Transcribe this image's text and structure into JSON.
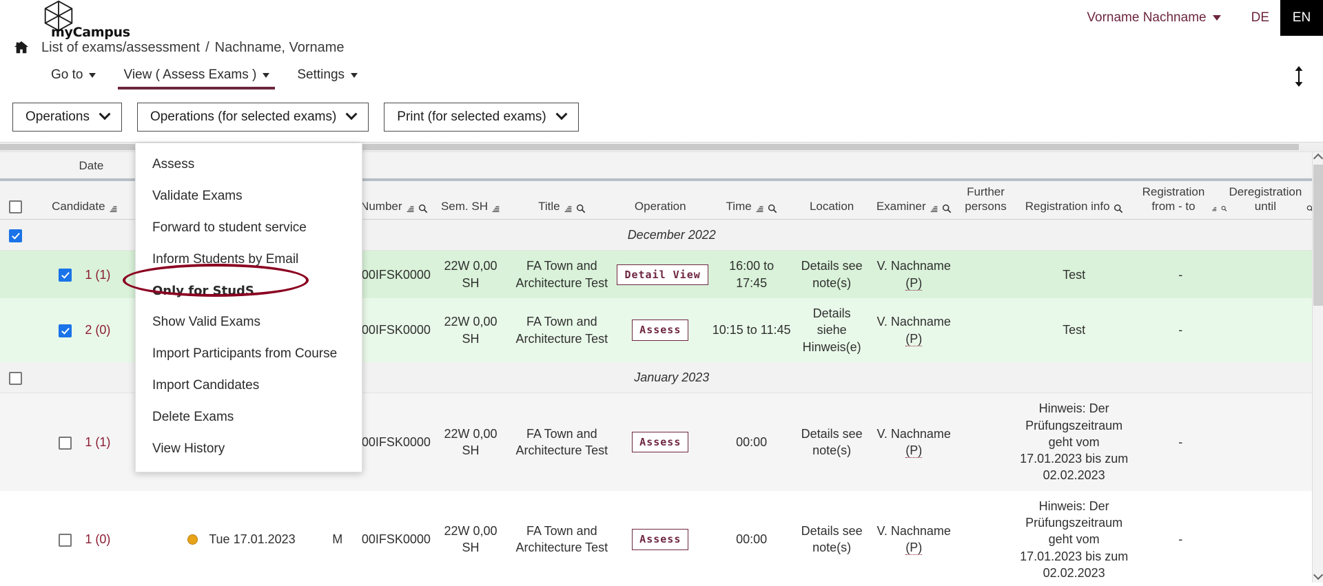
{
  "app": {
    "logo_text": "myCampus",
    "logo_icon": "hexagon-logo-icon"
  },
  "header": {
    "user_name": "Vorname Nachname",
    "lang_de": "DE",
    "lang_en": "EN"
  },
  "breadcrumb": {
    "home_icon": "home-icon",
    "page": "List of exams/assessment",
    "separator": "/",
    "person": "Nachname, Vorname"
  },
  "menubar": {
    "items": [
      {
        "label": "Go to",
        "active": false
      },
      {
        "label": "View ( Assess Exams )",
        "active": true
      },
      {
        "label": "Settings",
        "active": false
      }
    ],
    "expand_icon": "expand-collapse-icon"
  },
  "toolbar": {
    "operations": "Operations",
    "operations_selected": "Operations (for selected exams)",
    "print_selected": "Print (for selected exams)"
  },
  "dropdown": {
    "open_for": "Operations (for selected exams)",
    "items": [
      {
        "label": "Assess",
        "bold": false
      },
      {
        "label": "Validate Exams",
        "bold": false
      },
      {
        "label": "Forward to student service",
        "bold": false
      },
      {
        "label": "Inform Students by Email",
        "bold": false,
        "highlighted": true
      },
      {
        "label": "Only for StudS",
        "bold": true
      },
      {
        "label": "Show Valid Exams",
        "bold": false
      },
      {
        "label": "Import Participants from Course",
        "bold": false
      },
      {
        "label": "Import Candidates",
        "bold": false
      },
      {
        "label": "Delete Exams",
        "bold": false
      },
      {
        "label": "View History",
        "bold": false
      }
    ]
  },
  "table": {
    "group_label": "Date",
    "columns": [
      {
        "label": "Candidate",
        "sort": true,
        "search": true
      },
      {
        "label": "",
        "sort": false,
        "search": false
      },
      {
        "label": "",
        "sort": true,
        "search": true
      },
      {
        "label": "Number",
        "sort": true,
        "search": true
      },
      {
        "label": "Sem. SH",
        "sort": true,
        "search": false
      },
      {
        "label": "Title",
        "sort": true,
        "search": true
      },
      {
        "label": "Operation",
        "sort": false,
        "search": false
      },
      {
        "label": "Time",
        "sort": true,
        "search": true
      },
      {
        "label": "Location",
        "sort": false,
        "search": false
      },
      {
        "label": "Examiner",
        "sort": true,
        "search": true
      },
      {
        "label": "Further persons",
        "sort": false,
        "search": false
      },
      {
        "label": "Registration info",
        "sort": false,
        "search": true
      },
      {
        "label": "Registration from - to",
        "sort": true,
        "search": true
      },
      {
        "label": "Deregistration until",
        "sort": false,
        "search": true
      }
    ],
    "groups": [
      {
        "label": "December 2022",
        "checked": true,
        "rows": [
          {
            "checked": true,
            "candidate": "1 (1)",
            "date": "",
            "mark": "",
            "number": "00IFSK0000",
            "sem": "22W 0,00 SH",
            "title": "FA Town and Architecture Test",
            "operation": "Detail View",
            "time": "16:00 to 17:45",
            "location": "Details see note(s)",
            "examiner": "V. Nachname",
            "examiner_role": "(P)",
            "further_persons": "",
            "registration_info": "Test",
            "registration_from_to": "-",
            "deregistration_until": "",
            "style": "row-green-1"
          },
          {
            "checked": true,
            "candidate": "2 (0)",
            "date": "",
            "mark": "",
            "number": "00IFSK0000",
            "sem": "22W 0,00 SH",
            "title": "FA Town and Architecture Test",
            "operation": "Assess",
            "time": "10:15 to 11:45",
            "location": "Details siehe Hinweis(e)",
            "examiner": "V. Nachname",
            "examiner_role": "(P)",
            "further_persons": "",
            "registration_info": "Test",
            "registration_from_to": "-",
            "deregistration_until": "",
            "style": "row-green-2"
          }
        ]
      },
      {
        "label": "January 2023",
        "checked": false,
        "rows": [
          {
            "checked": false,
            "candidate": "1 (1)",
            "date": "",
            "mark": "",
            "number": "00IFSK0000",
            "sem": "22W 0,00 SH",
            "title": "FA Town and Architecture Test",
            "operation": "Assess",
            "time": "00:00",
            "location": "Details see note(s)",
            "examiner": "V. Nachname",
            "examiner_role": "(P)",
            "further_persons": "",
            "registration_info": "Hinweis: Der Prüfungszeitraum geht vom 17.01.2023 bis zum 02.02.2023",
            "registration_from_to": "-",
            "deregistration_until": "",
            "style": "row-grey"
          },
          {
            "checked": false,
            "candidate": "1 (0)",
            "date": "Tue 17.01.2023",
            "mark": "M",
            "status_dot": "amber-status-dot",
            "number": "00IFSK0000",
            "sem": "22W 0,00 SH",
            "title": "FA Town and Architecture Test",
            "operation": "Assess",
            "time": "00:00",
            "location": "Details see note(s)",
            "examiner": "V. Nachname",
            "examiner_role": "(P)",
            "further_persons": "",
            "registration_info": "Hinweis: Der Prüfungszeitraum geht vom 17.01.2023 bis zum 02.02.2023",
            "registration_from_to": "-",
            "deregistration_until": "",
            "style": "row-white"
          }
        ]
      }
    ]
  },
  "colors": {
    "brand": "#6d2640",
    "link": "#8b1d33",
    "annotation": "#8b0020",
    "row_green_dark": "#d9f2d9",
    "row_green_light": "#e9f9e9",
    "checkbox_checked": "#1a73e8",
    "status_amber": "#e8a317"
  }
}
